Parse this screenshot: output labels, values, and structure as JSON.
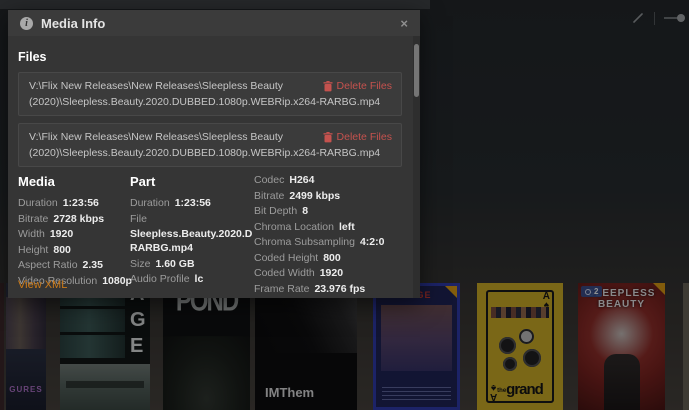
{
  "toolbar": {
    "edit_icon": "edit-pencil",
    "toggle_icon": "view-toggle"
  },
  "modal": {
    "title": "Media Info",
    "close_glyph": "×",
    "info_glyph": "i",
    "files": {
      "heading": "Files",
      "items": [
        {
          "path_line1": "V:\\Flix New Releases\\New Releases\\Sleepless Beauty",
          "path_line2": "(2020)\\Sleepless.Beauty.2020.DUBBED.1080p.WEBRip.x264-RARBG.mp4",
          "delete_label": "Delete Files"
        },
        {
          "path_line1": "V:\\Flix New Releases\\New Releases\\Sleepless Beauty",
          "path_line2": "(2020)\\Sleepless.Beauty.2020.DUBBED.1080p.WEBRip.x264-RARBG.mp4",
          "delete_label": "Delete Files"
        }
      ]
    },
    "media": {
      "heading": "Media",
      "rows": [
        {
          "label": "Duration",
          "value": "1:23:56"
        },
        {
          "label": "Bitrate",
          "value": "2728 kbps"
        },
        {
          "label": "Width",
          "value": "1920"
        },
        {
          "label": "Height",
          "value": "800"
        },
        {
          "label": "Aspect Ratio",
          "value": "2.35"
        },
        {
          "label": "Video Resolution",
          "value": "1080p"
        }
      ]
    },
    "part": {
      "heading": "Part",
      "duration": {
        "label": "Duration",
        "value": "1:23:56"
      },
      "file": {
        "label": "File",
        "value_line1": "Sleepless.Beauty.2020.D",
        "value_line2": "RARBG.mp4"
      },
      "size": {
        "label": "Size",
        "value": "1.60 GB"
      },
      "audio_profile": {
        "label": "Audio Profile",
        "value": "lc"
      }
    },
    "stream": {
      "rows": [
        {
          "label": "Codec",
          "value": "H264"
        },
        {
          "label": "Bitrate",
          "value": "2499 kbps"
        },
        {
          "label": "Bit Depth",
          "value": "8"
        },
        {
          "label": "Chroma Location",
          "value": "left"
        },
        {
          "label": "Chroma Subsampling",
          "value": "4:2:0"
        },
        {
          "label": "Coded Height",
          "value": "800"
        },
        {
          "label": "Coded Width",
          "value": "1920"
        },
        {
          "label": "Frame Rate",
          "value": "23.976 fps"
        }
      ]
    },
    "view_xml_label": "View XML"
  },
  "posters": {
    "pleasures_text": "GURES",
    "age_letters": [
      "A",
      "G",
      "E"
    ],
    "pond_title": "POND",
    "imthem_title": "IMThem",
    "cage_title": "CAGE",
    "grand_prefix": "the",
    "grand_title": "grand",
    "grand_rank": "A",
    "grand_suit": "♠",
    "sleepless_line1": "SLEEPLESS",
    "sleepless_line2": "BEAUTY",
    "sleepless_badge_count": "2"
  },
  "colors": {
    "accent_orange": "#cc7b19",
    "delete_red": "#c5524e",
    "unwatched_flag": "#e5a00d"
  }
}
